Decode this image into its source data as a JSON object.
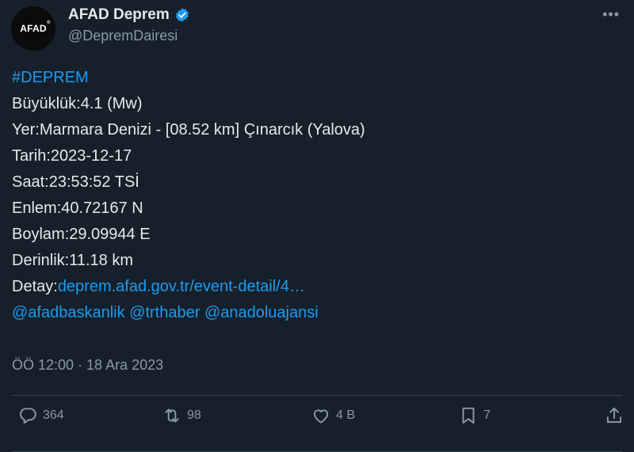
{
  "author": {
    "display_name": "AFAD Deprem",
    "handle": "@DepremDairesi",
    "avatar_text": "AFAD",
    "avatar_mark": "®"
  },
  "post": {
    "hashtag": "#DEPREM",
    "lines": [
      "Büyüklük:4.1 (Mw)",
      "Yer:Marmara Denizi - [08.52 km] Çınarcık (Yalova)",
      "Tarih:2023-12-17",
      "Saat:23:53:52 TSİ",
      "Enlem:40.72167 N",
      "Boylam:29.09944 E",
      "Derinlik:11.18 km"
    ],
    "detail_label": "Detay:",
    "detail_link": "deprem.afad.gov.tr/event-detail/4…",
    "mentions": "@afadbaskanlik @trthaber @anadoluajansi",
    "timestamp": "ÖÖ 12:00 · 18 Ara 2023"
  },
  "actions": {
    "replies": "364",
    "reposts": "98",
    "likes": "4 B",
    "bookmarks": "7"
  },
  "colors": {
    "background": "#15202b",
    "link": "#1d9bf0",
    "muted": "#8b98a5",
    "text": "#e7e9ea"
  },
  "icons": [
    "verified-badge-icon",
    "more-icon",
    "reply-icon",
    "repost-icon",
    "like-icon",
    "bookmark-icon",
    "share-icon"
  ]
}
